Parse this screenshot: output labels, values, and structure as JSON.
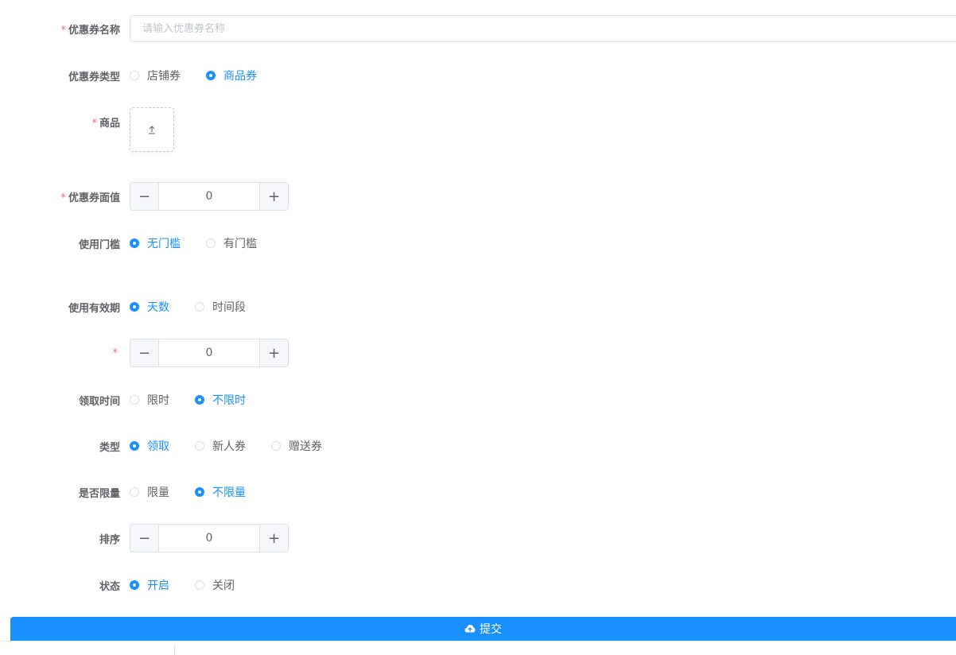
{
  "form": {
    "coupon_name": {
      "label": "优惠券名称",
      "required_mark": "*",
      "placeholder": "请输入优惠券名称",
      "value": ""
    },
    "coupon_type": {
      "label": "优惠券类型",
      "options": [
        "店铺券",
        "商品券"
      ],
      "selected": "商品券"
    },
    "product": {
      "label": "商品",
      "required_mark": "*"
    },
    "face_value": {
      "label": "优惠券面值",
      "required_mark": "*",
      "value": "0",
      "minus": "−",
      "plus": "+"
    },
    "threshold": {
      "label": "使用门槛",
      "options": [
        "无门槛",
        "有门槛"
      ],
      "selected": "无门槛"
    },
    "validity": {
      "label": "使用有效期",
      "options": [
        "天数",
        "时间段"
      ],
      "selected": "天数"
    },
    "days": {
      "required_mark": "*",
      "value": "0",
      "minus": "−",
      "plus": "+"
    },
    "claim_time": {
      "label": "领取时间",
      "options": [
        "限时",
        "不限时"
      ],
      "selected": "不限时"
    },
    "kind": {
      "label": "类型",
      "options": [
        "领取",
        "新人券",
        "赠送券"
      ],
      "selected": "领取"
    },
    "limit": {
      "label": "是否限量",
      "options": [
        "限量",
        "不限量"
      ],
      "selected": "不限量"
    },
    "sort": {
      "label": "排序",
      "value": "0",
      "minus": "−",
      "plus": "+"
    },
    "status": {
      "label": "状态",
      "options": [
        "开启",
        "关闭"
      ],
      "selected": "开启"
    },
    "submit_label": "提交"
  },
  "colors": {
    "primary": "#1890ff",
    "required": "#f56c6c",
    "border": "#dcdfe6",
    "text": "#606266"
  }
}
